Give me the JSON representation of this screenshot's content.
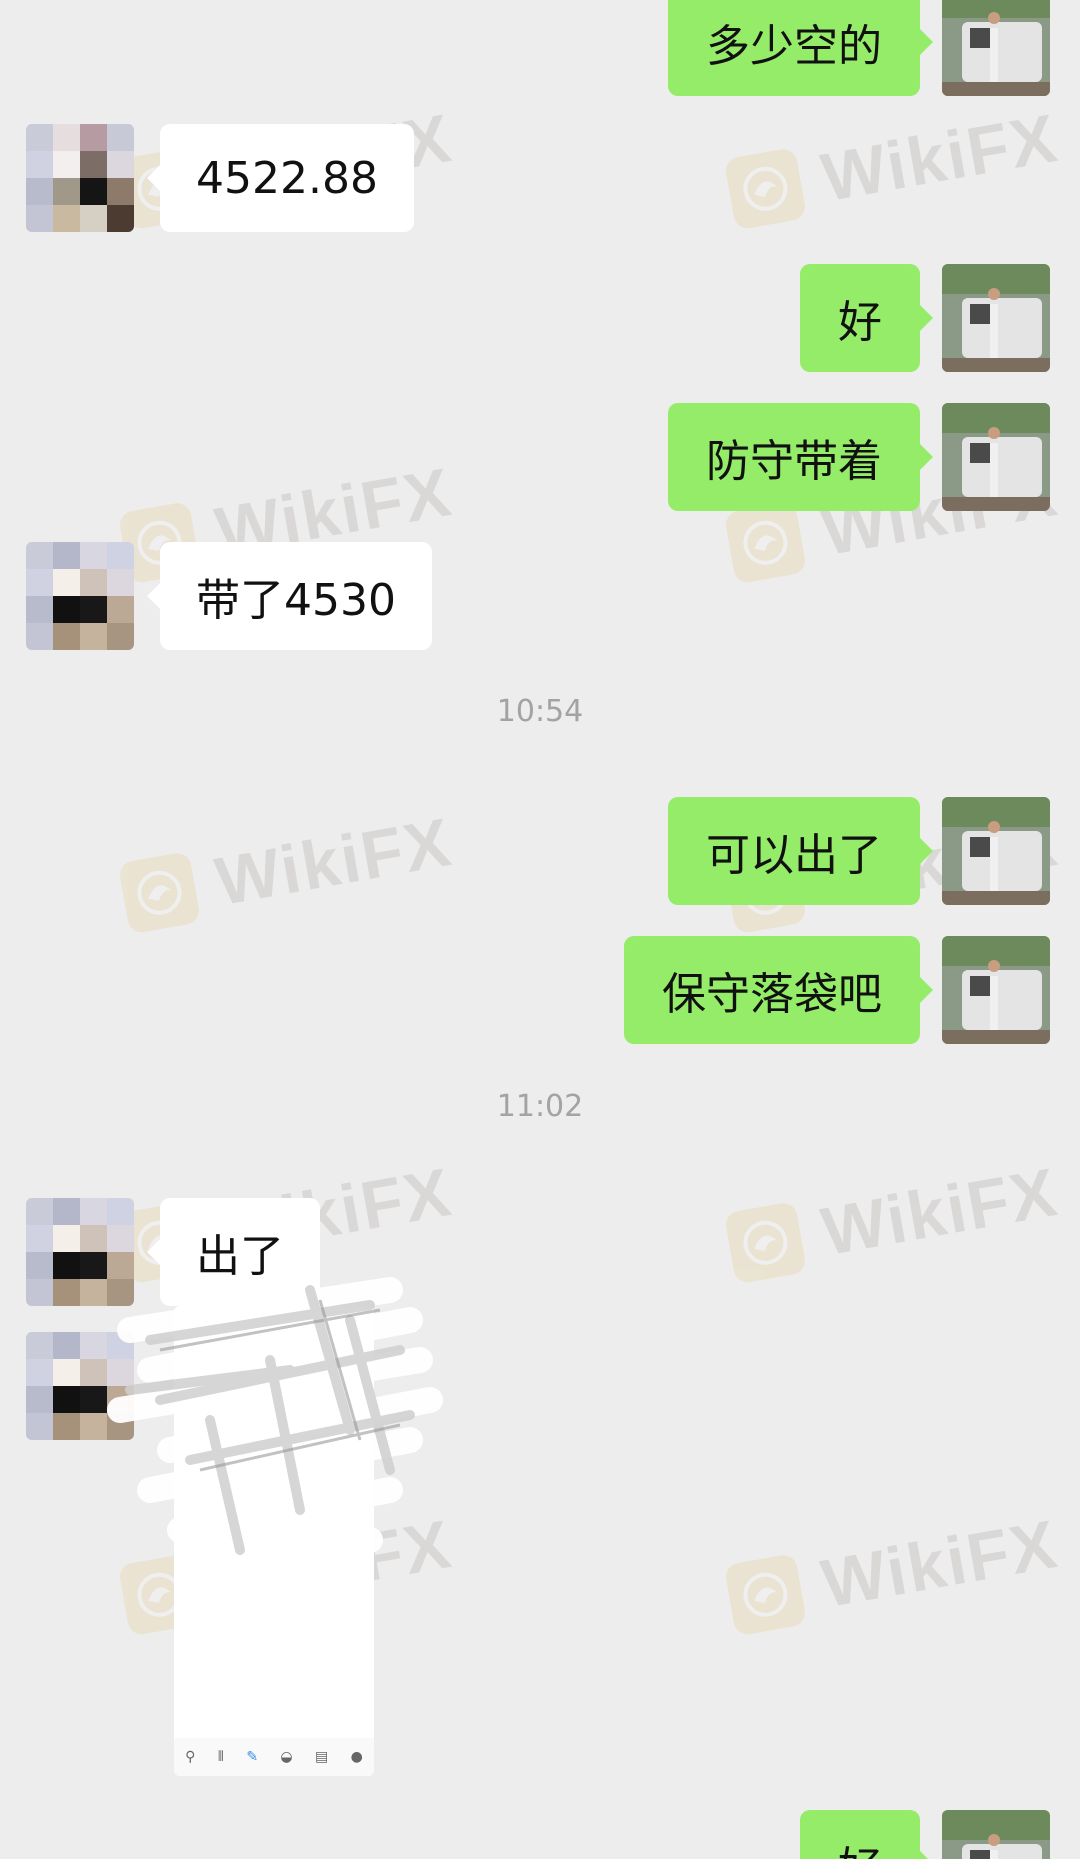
{
  "messages": [
    {
      "side": "right",
      "text": "多少空的"
    },
    {
      "side": "left",
      "text": "4522.88"
    },
    {
      "side": "right",
      "text": "好"
    },
    {
      "side": "right",
      "text": "防守带着"
    },
    {
      "side": "left",
      "text": "带了4530"
    },
    {
      "side": "right",
      "text": "可以出了"
    },
    {
      "side": "right",
      "text": "保守落袋吧"
    },
    {
      "side": "left",
      "text": "出了"
    },
    {
      "side": "right",
      "text": "好"
    }
  ],
  "timestamps": [
    "10:54",
    "11:02"
  ],
  "watermark": {
    "text": "WikiFX",
    "logo": "wikifx-eagle-logo"
  },
  "image_message": {
    "toolbar_icons": [
      "link-icon",
      "signal-icon",
      "pen-icon",
      "inbox-icon",
      "list-icon",
      "chat-icon"
    ]
  },
  "colors": {
    "background": "#ededed",
    "outgoing_bubble": "#95ec69",
    "incoming_bubble": "#ffffff",
    "timestamp": "#a3a3a3"
  }
}
